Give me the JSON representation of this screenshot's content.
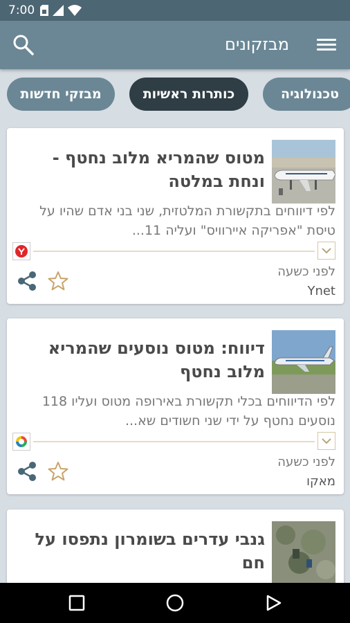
{
  "status_bar": {
    "time": "7:00"
  },
  "app_bar": {
    "title": "מבזקונים"
  },
  "chips": [
    {
      "label": "טכנולוגיה",
      "active": false
    },
    {
      "label": "כותרות ראשיות",
      "active": true
    },
    {
      "label": "מבזקי חדשות",
      "active": false
    }
  ],
  "articles": [
    {
      "headline": "מטוס שהמריא מלוב נחטף - ונחת במלטה",
      "summary": "לפי דיווחים בתקשורת המלטזית, שני בני אדם שהיו על טיסת \"אפריקה איירוויס\" ועליה 11...",
      "time_ago": "לפני כשעה",
      "source": "Ynet",
      "source_logo": "ynet-logo",
      "thumbnail": "airplane-at-airport-image"
    },
    {
      "headline": "דיווח: מטוס נוסעים שהמריא מלוב נחטף",
      "summary": "לפי הדיווחים בכלי תקשורת באירופה מטוס ועליו 118 נוסעים נחטף על ידי שני חשודים שא...",
      "time_ago": "לפני כשעה",
      "source": "מאקו",
      "source_logo": "mako-logo",
      "thumbnail": "airplane-on-runway-image"
    },
    {
      "headline": "גנבי עדרים בשומרון נתפסו על חם",
      "thumbnail": "hillside-image"
    }
  ],
  "icons": {
    "search": "search-icon",
    "menu": "hamburger-menu-icon",
    "share": "share-icon",
    "star": "star-outline-icon",
    "expand": "chevron-down-icon"
  },
  "colors": {
    "app_bar": "#6b8795",
    "status_bar": "#4d6673",
    "chip_active": "#2f3d44",
    "background": "#d6dde3",
    "star": "#c8a46a"
  }
}
